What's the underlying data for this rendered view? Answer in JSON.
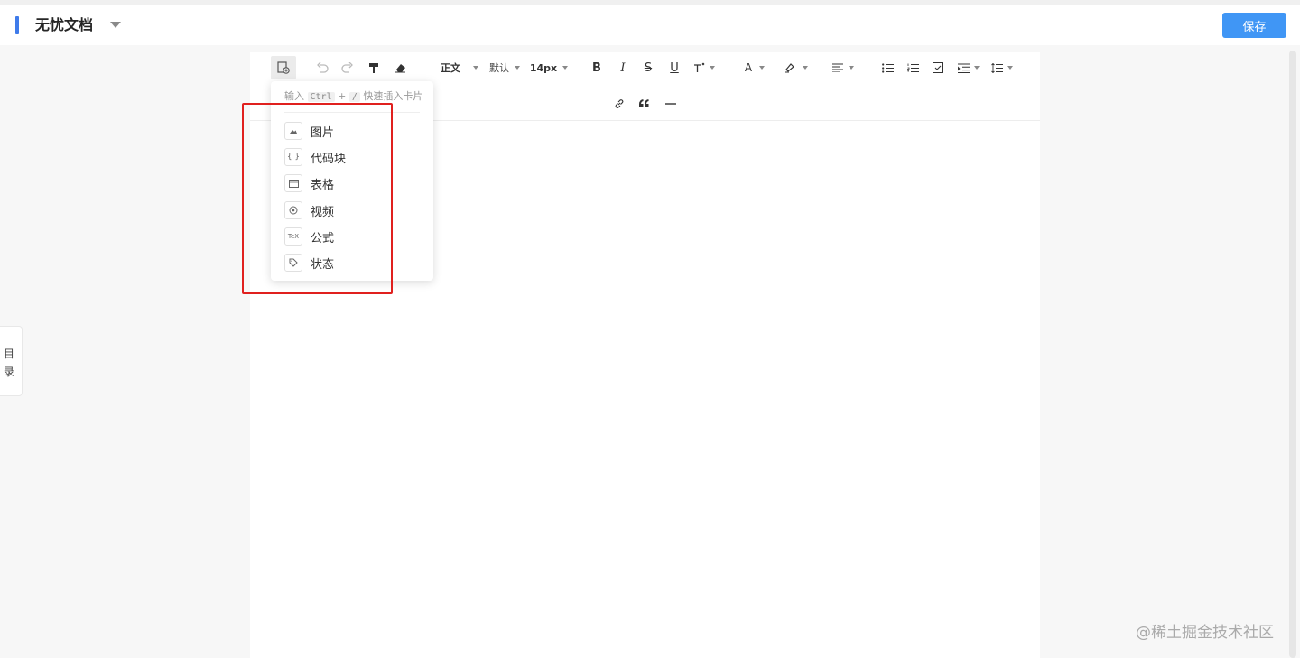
{
  "header": {
    "title": "无忧文档",
    "save_label": "保存",
    "accent_color": "#3f7bea",
    "save_color": "#4096f5"
  },
  "toc": {
    "label": "目录"
  },
  "toolbar": {
    "insert_icon": "insert-card-icon",
    "undo_icon": "undo-icon",
    "redo_icon": "redo-icon",
    "format_painter_icon": "format-painter-icon",
    "clear_format_icon": "eraser-icon",
    "heading_select": "正文",
    "font_family_select": "默认",
    "font_size_select": "14px",
    "bold": "B",
    "italic": "I",
    "strike": "S",
    "underline": "U",
    "more_text_style_icon": "superscript-icon",
    "font_color": "A",
    "highlight_icon": "highlighter-icon",
    "align_icon": "align-left-icon",
    "unordered_list_icon": "bullet-list-icon",
    "ordered_list_icon": "numbered-list-icon",
    "task_list_icon": "checkbox-list-icon",
    "indent_icon": "indent-icon",
    "line_height_icon": "line-height-icon",
    "link_icon": "link-icon",
    "quote_icon": "quote-icon",
    "hr_icon": "horizontal-rule-icon"
  },
  "insert_popup": {
    "hint_prefix": "输入",
    "hint_key1": "Ctrl",
    "hint_plus": "+",
    "hint_key2": "/",
    "hint_suffix": "快速插入卡片",
    "items": [
      {
        "label": "图片",
        "icon": "image-icon"
      },
      {
        "label": "代码块",
        "icon": "code-block-icon",
        "glyph": "{ }"
      },
      {
        "label": "表格",
        "icon": "table-icon"
      },
      {
        "label": "视频",
        "icon": "video-icon"
      },
      {
        "label": "公式",
        "icon": "formula-icon",
        "glyph": "TeX"
      },
      {
        "label": "状态",
        "icon": "status-icon"
      }
    ]
  },
  "watermark": "@稀土掘金技术社区",
  "highlight_color": "#e0201e"
}
